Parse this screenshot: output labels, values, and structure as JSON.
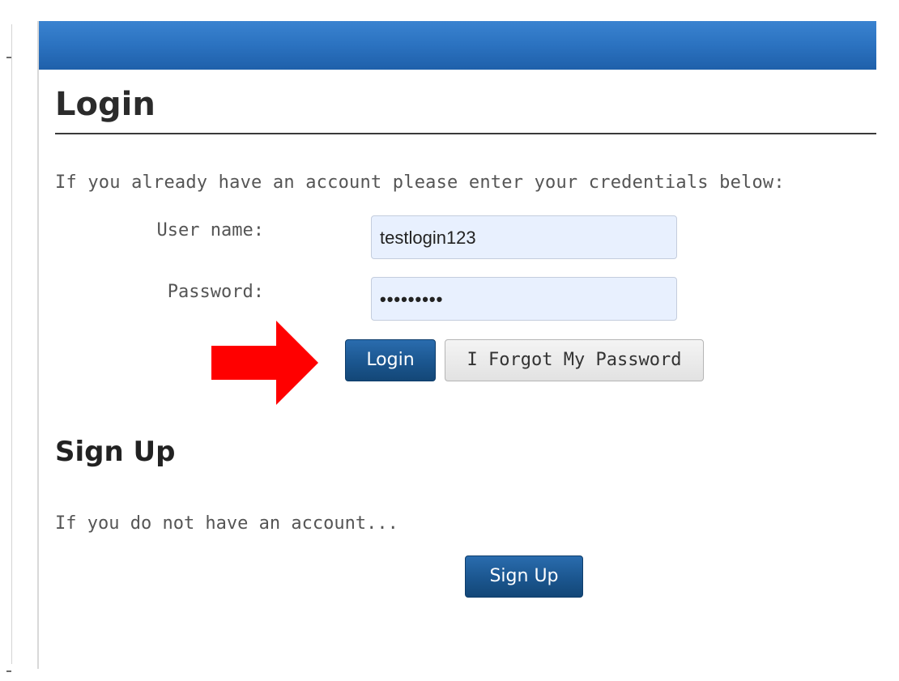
{
  "login": {
    "title": "Login",
    "intro": "If you already have an account please enter your credentials below:",
    "username_label": "User name:",
    "username_value": "testlogin123",
    "password_label": "Password:",
    "password_value": "•••••••••",
    "login_button": "Login",
    "forgot_button": "I Forgot My Password"
  },
  "signup": {
    "title": "Sign Up",
    "text": "If you do not have an account...",
    "button": "Sign Up"
  },
  "colors": {
    "header": "#2b72c0",
    "primary_button": "#1b568f",
    "arrow": "#ff0000",
    "input_background": "#e8f0fe"
  },
  "icons": {
    "pointer": "right-arrow-icon"
  }
}
